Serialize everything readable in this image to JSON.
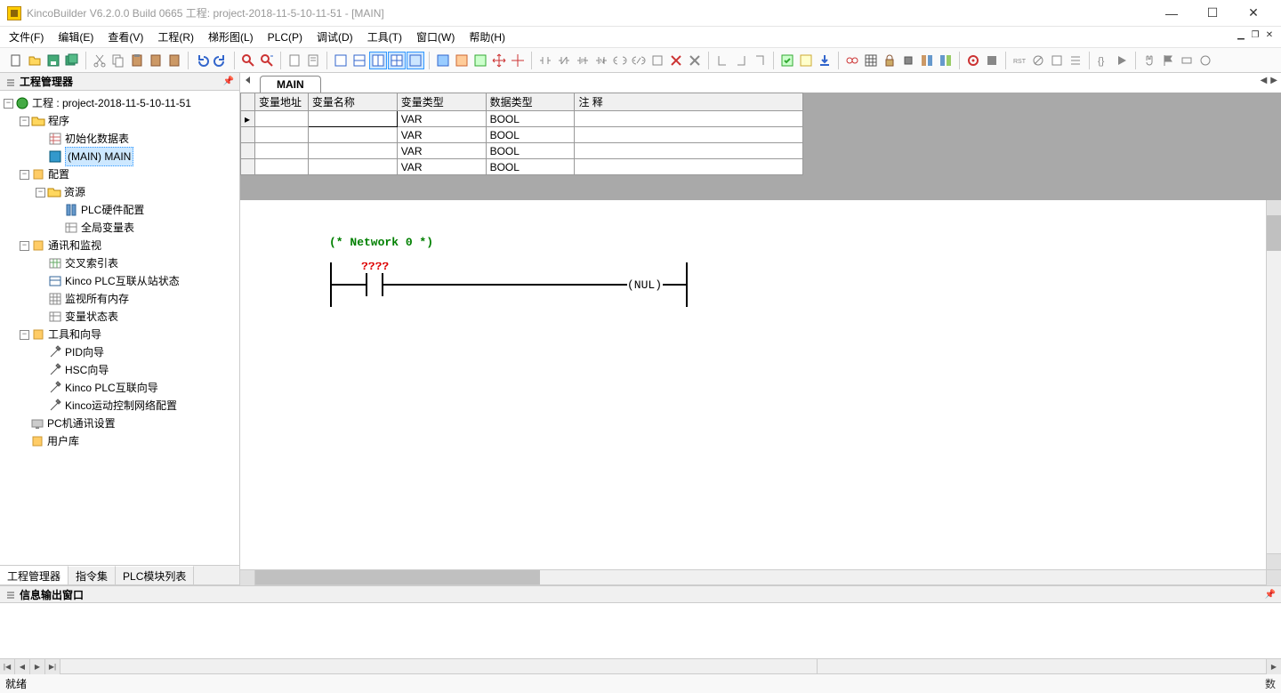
{
  "window": {
    "title": "KincoBuilder V6.2.0.0 Build 0665   工程: project-2018-11-5-10-11-51 - [MAIN]"
  },
  "menu": {
    "file": "文件(F)",
    "edit": "编辑(E)",
    "view": "查看(V)",
    "project": "工程(R)",
    "ladder": "梯形图(L)",
    "plc": "PLC(P)",
    "debug": "调试(D)",
    "tools": "工具(T)",
    "window": "窗口(W)",
    "help": "帮助(H)"
  },
  "panels": {
    "project_manager": "工程管理器",
    "output_window": "信息输出窗口"
  },
  "left_tabs": [
    "工程管理器",
    "指令集",
    "PLC模块列表"
  ],
  "tree": {
    "root": "工程 : project-2018-11-5-10-11-51",
    "program": "程序",
    "init_table": "初始化数据表",
    "main": "(MAIN)  MAIN",
    "config": "配置",
    "resource": "资源",
    "hw_config": "PLC硬件配置",
    "global_vars": "全局变量表",
    "comm": "通讯和监视",
    "cross_ref": "交叉索引表",
    "slave_status": "Kinco PLC互联从站状态",
    "monitor_mem": "监视所有内存",
    "var_status": "变量状态表",
    "tools_wiz": "工具和向导",
    "pid_wiz": "PID向导",
    "hsc_wiz": "HSC向导",
    "kinco_link_wiz": "Kinco PLC互联向导",
    "motion_wiz": "Kinco运动控制网络配置",
    "pc_comm": "PC机通讯设置",
    "user_lib": "用户库"
  },
  "tab": {
    "main": "MAIN"
  },
  "var_table": {
    "headers": [
      "变量地址",
      "变量名称",
      "变量类型",
      "数据类型",
      "注 释"
    ],
    "rows": [
      {
        "addr": "",
        "name": "",
        "type": "VAR",
        "dtype": "BOOL",
        "comment": ""
      },
      {
        "addr": "",
        "name": "",
        "type": "VAR",
        "dtype": "BOOL",
        "comment": ""
      },
      {
        "addr": "",
        "name": "",
        "type": "VAR",
        "dtype": "BOOL",
        "comment": ""
      },
      {
        "addr": "",
        "name": "",
        "type": "VAR",
        "dtype": "BOOL",
        "comment": ""
      }
    ]
  },
  "ladder": {
    "network_label": "(* Network 0 *)",
    "contact_label": "????",
    "coil_label": "(NUL)"
  },
  "status": {
    "ready": "就绪",
    "right": "数"
  }
}
